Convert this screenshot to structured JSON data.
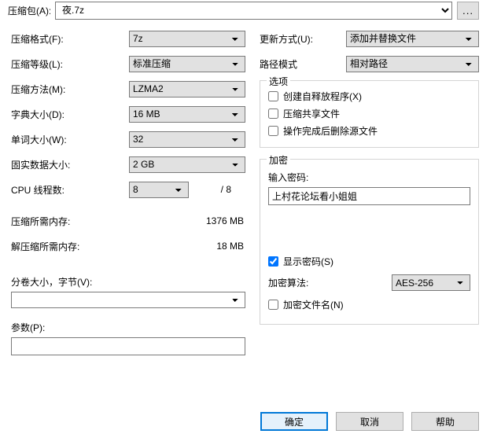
{
  "top": {
    "label": "压缩包(A):",
    "archive": "夜.7z",
    "browse": "..."
  },
  "left": {
    "format_label": "压缩格式(F):",
    "format": "7z",
    "level_label": "压缩等级(L):",
    "level": "标准压缩",
    "method_label": "压缩方法(M):",
    "method": "LZMA2",
    "dict_label": "字典大小(D):",
    "dict": "16 MB",
    "word_label": "单词大小(W):",
    "word": "32",
    "solid_label": "固实数据大小:",
    "solid": "2 GB",
    "threads_label": "CPU 线程数:",
    "threads": "8",
    "threads_total": "/ 8",
    "mem_compress_label": "压缩所需内存:",
    "mem_compress": "1376 MB",
    "mem_decompress_label": "解压缩所需内存:",
    "mem_decompress": "18 MB",
    "volume_label": "分卷大小，字节(V):",
    "volume": "",
    "params_label": "参数(P):",
    "params": ""
  },
  "right": {
    "update_label": "更新方式(U):",
    "update": "添加并替换文件",
    "path_label": "路径模式",
    "path": "相对路径",
    "options_title": "选项",
    "sfx_label": "创建自释放程序(X)",
    "shared_label": "压缩共享文件",
    "delete_label": "操作完成后删除源文件",
    "encrypt_title": "加密",
    "pwd_label": "输入密码:",
    "pwd_value": "上村花论坛看小姐姐",
    "show_pwd_label": "显示密码(S)",
    "alg_label": "加密算法:",
    "alg": "AES-256",
    "encrypt_names_label": "加密文件名(N)"
  },
  "buttons": {
    "ok": "确定",
    "cancel": "取消",
    "help": "帮助"
  }
}
